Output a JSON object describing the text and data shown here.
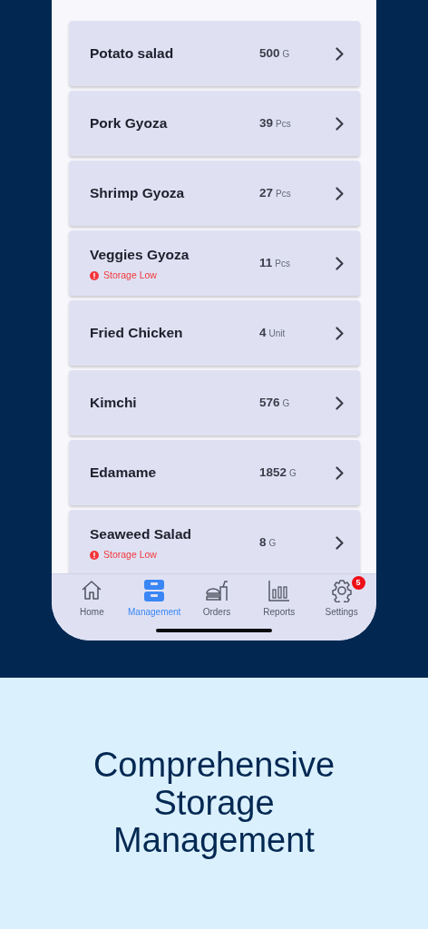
{
  "items": [
    {
      "name": "Potato salad",
      "amount": "500",
      "unit": "G"
    },
    {
      "name": "Pork Gyoza",
      "amount": "39",
      "unit": "Pcs"
    },
    {
      "name": "Shrimp Gyoza",
      "amount": "27",
      "unit": "Pcs"
    },
    {
      "name": "Veggies Gyoza",
      "amount": "11",
      "unit": "Pcs",
      "alert": "Storage Low"
    },
    {
      "name": "Fried Chicken",
      "amount": "4",
      "unit": "Unit"
    },
    {
      "name": "Kimchi",
      "amount": "576",
      "unit": "G"
    },
    {
      "name": "Edamame",
      "amount": "1852",
      "unit": "G"
    },
    {
      "name": "Seaweed Salad",
      "amount": "8",
      "unit": "G",
      "alert": "Storage Low"
    }
  ],
  "tab_bar": [
    {
      "kind": "home",
      "label": "Home",
      "selected": false
    },
    {
      "kind": "management",
      "label": "Management",
      "selected": true
    },
    {
      "kind": "orders",
      "label": "Orders",
      "selected": false
    },
    {
      "kind": "reports",
      "label": "Reports",
      "selected": false
    },
    {
      "kind": "settings",
      "label": "Settings",
      "selected": false,
      "badge": "5"
    }
  ],
  "headline": "Comprehensive Storage Management"
}
